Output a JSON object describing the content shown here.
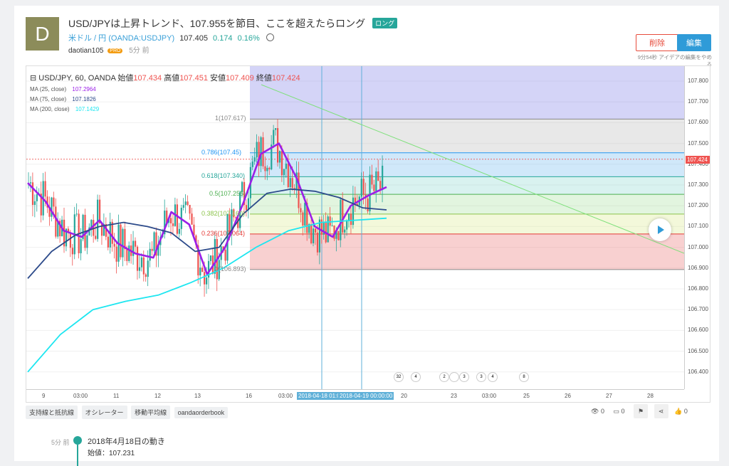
{
  "header": {
    "avatar_letter": "D",
    "title": "USD/JPYは上昇トレンド、107.955を節目、ここを超えたらロング",
    "badge": "ロング",
    "symbol_name": "米ドル / 円 (OANDA:USDJPY)",
    "price": "107.405",
    "change": "0.174",
    "change_pct": "0.16%",
    "author": "daotian105",
    "pro_badge": "PRO",
    "ago": "5分 前",
    "delete_label": "削除",
    "edit_label": "編集",
    "edit_note": "9分54秒 アイデアの編集をやめる"
  },
  "chart": {
    "symbol": "USD/JPY, 60, OANDA",
    "open_label": "始値",
    "open": "107.434",
    "high_label": "高値",
    "high": "107.451",
    "low_label": "安値",
    "low": "107.409",
    "close_label": "終値",
    "close": "107.424",
    "ma": [
      {
        "label": "MA (25, close)",
        "value": "107.2964",
        "color": "#9b1fe8"
      },
      {
        "label": "MA (75, close)",
        "value": "107.1826",
        "color": "#2c4a8a"
      },
      {
        "label": "MA (200, close)",
        "value": "107.1429",
        "color": "#1de6f0"
      }
    ],
    "price_ticks": [
      "107.800",
      "107.700",
      "107.600",
      "107.500",
      "107.400",
      "107.300",
      "107.200",
      "107.100",
      "107.000",
      "106.900",
      "106.800",
      "106.700",
      "106.600",
      "106.500",
      "106.400"
    ],
    "last_price_tag": "107.424",
    "time_ticks": [
      "9",
      "03:00",
      "11",
      "12",
      "13",
      "16",
      "03:00",
      "20",
      "23",
      "03:00",
      "25",
      "26",
      "27",
      "28"
    ],
    "time_highlights": [
      "2018-04-18 01:0",
      "2018-04-19 00:00:00"
    ],
    "fib_levels": [
      {
        "label": "1(107.617)",
        "price": 107.617,
        "color": "#888888"
      },
      {
        "label": "0.786(107.45)",
        "price": 107.455,
        "color": "#2196f3"
      },
      {
        "label": "0.618(107.340)",
        "price": 107.34,
        "color": "#26a69a"
      },
      {
        "label": "0.5(107.255)",
        "price": 107.255,
        "color": "#4caf50"
      },
      {
        "label": "0.382(107.160)",
        "price": 107.16,
        "color": "#8bc34a"
      },
      {
        "label": "0.236(107.064)",
        "price": 107.064,
        "color": "#e53935"
      },
      {
        "label": "0(106.893)",
        "price": 106.893,
        "color": "#888888"
      }
    ],
    "events": [
      "32",
      "4",
      "2",
      "",
      "3",
      "3",
      "4",
      "8"
    ]
  },
  "chart_data": {
    "type": "line",
    "title": "USD/JPY, 60, OANDA",
    "ylim": [
      106.35,
      107.85
    ],
    "series": [
      {
        "name": "MA (25, close)",
        "values": [
          107.31,
          107.22,
          107.08,
          107.05,
          107.13,
          107.02,
          106.97,
          106.95,
          107.17,
          107.11,
          106.87,
          107.0,
          107.21,
          107.45,
          107.5,
          107.33,
          107.1,
          107.05,
          107.2,
          107.25,
          107.29
        ]
      },
      {
        "name": "MA (75, close)",
        "values": [
          106.85,
          106.98,
          107.06,
          107.1,
          107.12,
          107.1,
          107.07,
          106.98,
          107.0,
          107.16,
          107.26,
          107.28,
          107.27,
          107.24,
          107.19,
          107.18
        ]
      },
      {
        "name": "MA (200, close)",
        "values": [
          106.4,
          106.58,
          106.7,
          106.74,
          106.77,
          106.83,
          106.9,
          107.0,
          107.08,
          107.12,
          107.13,
          107.14
        ]
      }
    ]
  },
  "tags": [
    "支持線と抵抗線",
    "オシレーター",
    "移動平均線",
    "oandaorderbook"
  ],
  "stats": {
    "views": "0",
    "comments": "0",
    "likes": "0"
  },
  "timeline": {
    "ago": "5分 前",
    "title": "2018年4月18日の動き",
    "value": "始値：107.231"
  }
}
